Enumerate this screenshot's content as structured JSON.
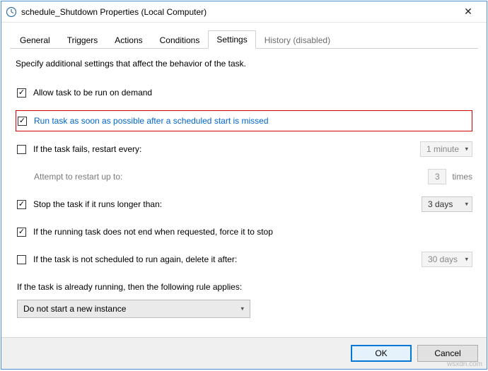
{
  "window": {
    "title": "schedule_Shutdown Properties (Local Computer)"
  },
  "tabs": [
    {
      "label": "General"
    },
    {
      "label": "Triggers"
    },
    {
      "label": "Actions"
    },
    {
      "label": "Conditions"
    },
    {
      "label": "Settings",
      "active": true
    },
    {
      "label": "History (disabled)"
    }
  ],
  "settings": {
    "intro": "Specify additional settings that affect the behavior of the task.",
    "allow_on_demand": {
      "label": "Allow task to be run on demand",
      "checked": true
    },
    "run_asap": {
      "label": "Run task as soon as possible after a scheduled start is missed",
      "checked": true
    },
    "if_fails": {
      "label": "If the task fails, restart every:",
      "checked": false,
      "interval": "1 minute"
    },
    "attempt_label": "Attempt to restart up to:",
    "attempt_count": "3",
    "attempt_times": "times",
    "stop_if_longer": {
      "label": "Stop the task if it runs longer than:",
      "checked": true,
      "duration": "3 days"
    },
    "force_stop": {
      "label": "If the running task does not end when requested, force it to stop",
      "checked": true
    },
    "delete_after": {
      "label": "If the task is not scheduled to run again, delete it after:",
      "checked": false,
      "duration": "30 days"
    },
    "already_running_label": "If the task is already running, then the following rule applies:",
    "already_running_value": "Do not start a new instance"
  },
  "buttons": {
    "ok": "OK",
    "cancel": "Cancel"
  },
  "watermark": "wsxdn.com"
}
